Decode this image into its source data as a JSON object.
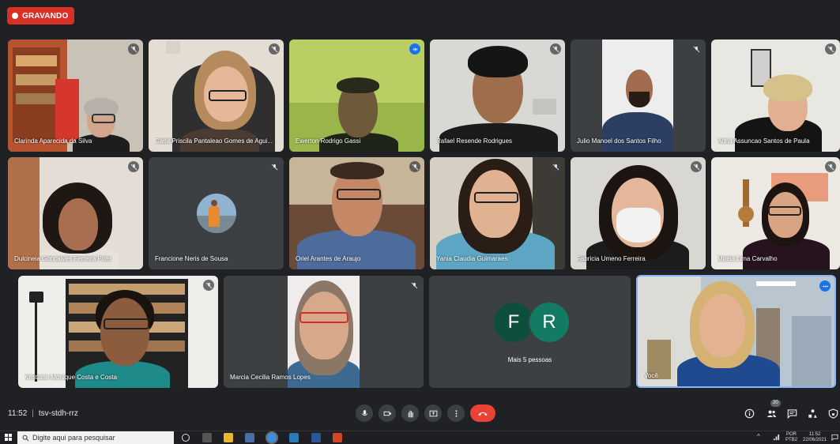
{
  "recording": {
    "label": "GRAVANDO"
  },
  "participants": [
    {
      "name": "Clarinda Aparecida da Silva"
    },
    {
      "name": "Carla Priscila Pantaleao Gomes de Agui..."
    },
    {
      "name": "Ewerton Rodrigo Gassi"
    },
    {
      "name": "Rafael Resende Rodrigues"
    },
    {
      "name": "Julio Manoel dos Santos Filho"
    },
    {
      "name": "Adria Assuncao Santos de Paula"
    },
    {
      "name": "Dulcineia Goncalves Ferreira Pires"
    },
    {
      "name": "Francione Neris de Sousa"
    },
    {
      "name": "Oriel Arantes de Araujo"
    },
    {
      "name": "Yania Claudia Guimaraes"
    },
    {
      "name": "Fabricia Umeno Ferreira"
    },
    {
      "name": "Mirela Lima Carvalho"
    },
    {
      "name": "Kristiane Monique Costa e Costa"
    },
    {
      "name": "Marcia Cecilia Ramos Lopes"
    },
    {
      "name": "Você"
    }
  ],
  "others_tile": {
    "initial_1": "F",
    "initial_2": "R",
    "label": "Mais 5 pessoas"
  },
  "meeting": {
    "time": "11:52",
    "code": "tsv-stdh-rrz",
    "participant_count": "20"
  },
  "colors": {
    "background": "#202124",
    "tile": "#3c4043",
    "hangup": "#ea4335",
    "recording": "#d93025",
    "speaking": "#1a73e8"
  },
  "taskbar": {
    "search_placeholder": "Digite aqui para pesquisar",
    "lang": "POR",
    "lang_sub": "PTB2",
    "clock": "11:52",
    "date": "22/06/2021"
  }
}
